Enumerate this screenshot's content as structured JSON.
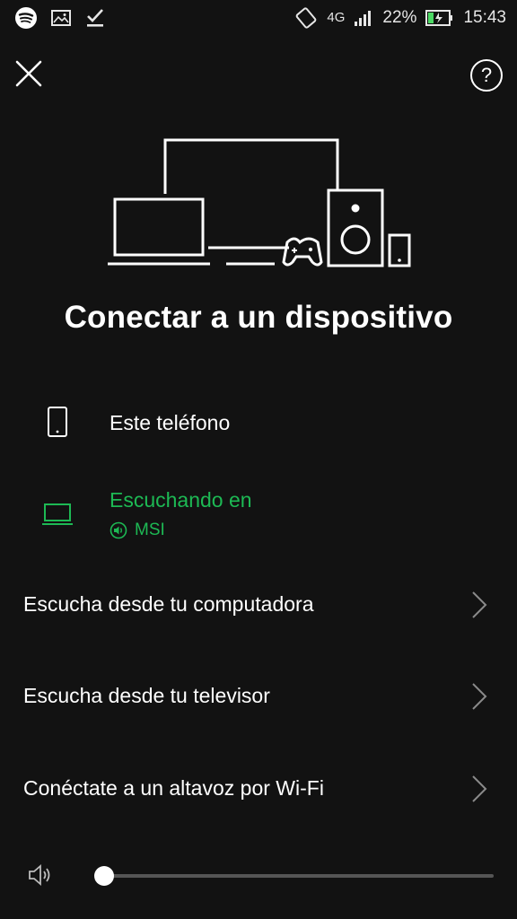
{
  "status_bar": {
    "network": "4G",
    "battery": "22%",
    "time": "15:43",
    "icons": [
      "spotify-icon",
      "gallery-icon",
      "download-done-icon",
      "rotate-icon",
      "signal-icon",
      "battery-charging-icon"
    ]
  },
  "header": {
    "help_label": "?"
  },
  "title": "Conectar a un dispositivo",
  "devices": [
    {
      "name": "Este teléfono",
      "icon": "phone-icon"
    },
    {
      "name": "Escuchando en",
      "sub": "MSI",
      "icon": "laptop-icon",
      "active": true
    }
  ],
  "options": [
    {
      "label": "Escucha desde tu computadora"
    },
    {
      "label": "Escucha desde tu televisor"
    },
    {
      "label": "Conéctate a un altavoz por Wi-Fi"
    }
  ],
  "volume": {
    "level": 0.0
  },
  "colors": {
    "background": "#121212",
    "accent": "#1db954",
    "text": "#ffffff",
    "muted": "#8a8a8a"
  }
}
